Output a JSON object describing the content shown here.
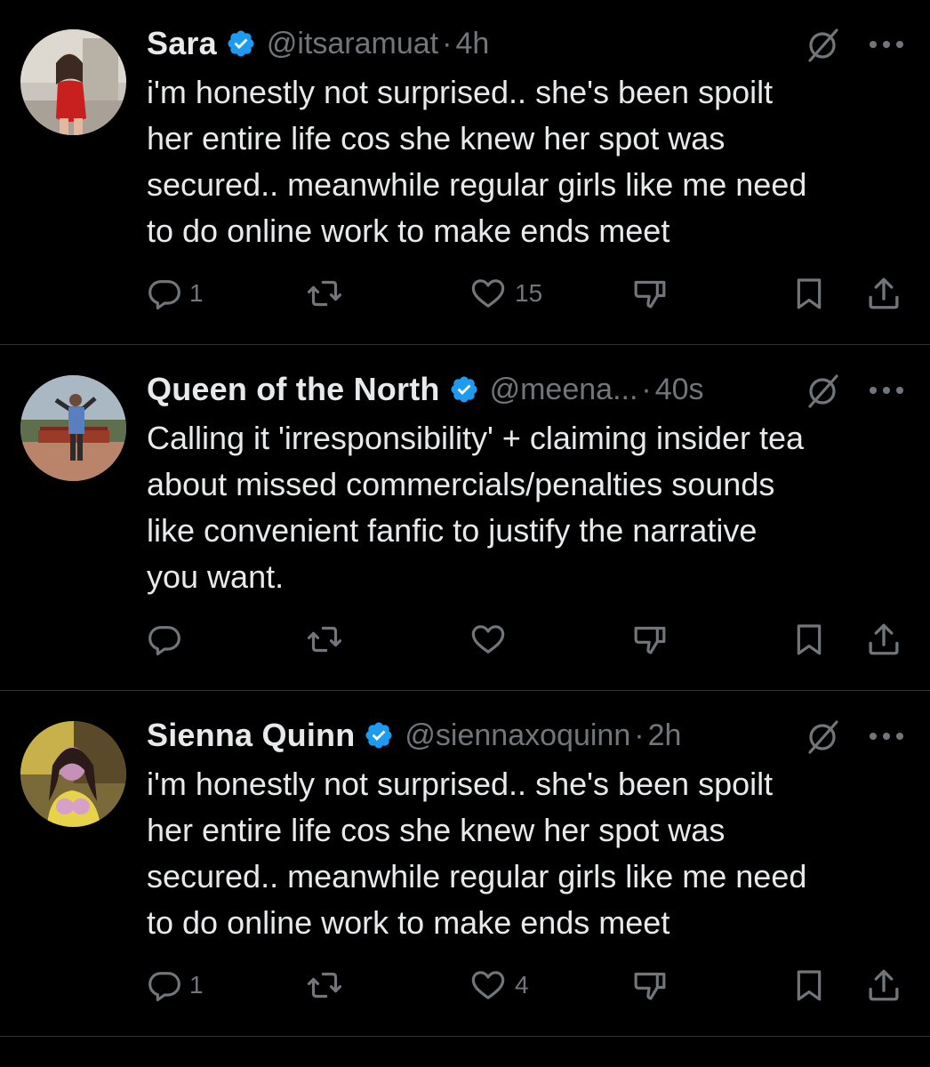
{
  "colors": {
    "background": "#000000",
    "text_primary": "#e7e9ea",
    "text_secondary": "#71767b",
    "verified_badge": "#1d9bf0",
    "divider": "#2f3336"
  },
  "tweets": [
    {
      "display_name": "Sara",
      "handle": "@itsaramuat",
      "separator": "·",
      "time": "4h",
      "text": "i'm honestly not surprised.. she's been spoilt\nher entire life cos she knew her spot was\nsecured.. meanwhile regular girls like me need\nto do online work to make ends meet",
      "reply_count": "1",
      "retweet_count": "",
      "like_count": "15",
      "icons": [
        "verified-badge-icon",
        "grok-icon",
        "more-icon",
        "reply-icon",
        "retweet-icon",
        "like-icon",
        "dislike-icon",
        "bookmark-icon",
        "share-icon"
      ]
    },
    {
      "display_name": "Queen of the North",
      "handle": "@meena...",
      "separator": "·",
      "time": "40s",
      "text": "Calling it 'irresponsibility' + claiming insider tea\nabout missed commercials/penalties sounds\nlike convenient fanfic to justify the narrative\nyou want.",
      "reply_count": "",
      "retweet_count": "",
      "like_count": "",
      "icons": [
        "verified-badge-icon",
        "grok-icon",
        "more-icon",
        "reply-icon",
        "retweet-icon",
        "like-icon",
        "dislike-icon",
        "bookmark-icon",
        "share-icon"
      ]
    },
    {
      "display_name": "Sienna Quinn",
      "handle": "@siennaxoquinn",
      "separator": "·",
      "time": "2h",
      "text": "i'm honestly not surprised.. she's been spoilt\nher entire life cos she knew her spot was\nsecured.. meanwhile regular girls like me need\nto do online work to make ends meet",
      "reply_count": "1",
      "retweet_count": "",
      "like_count": "4",
      "icons": [
        "verified-badge-icon",
        "grok-icon",
        "more-icon",
        "reply-icon",
        "retweet-icon",
        "like-icon",
        "dislike-icon",
        "bookmark-icon",
        "share-icon"
      ]
    }
  ]
}
